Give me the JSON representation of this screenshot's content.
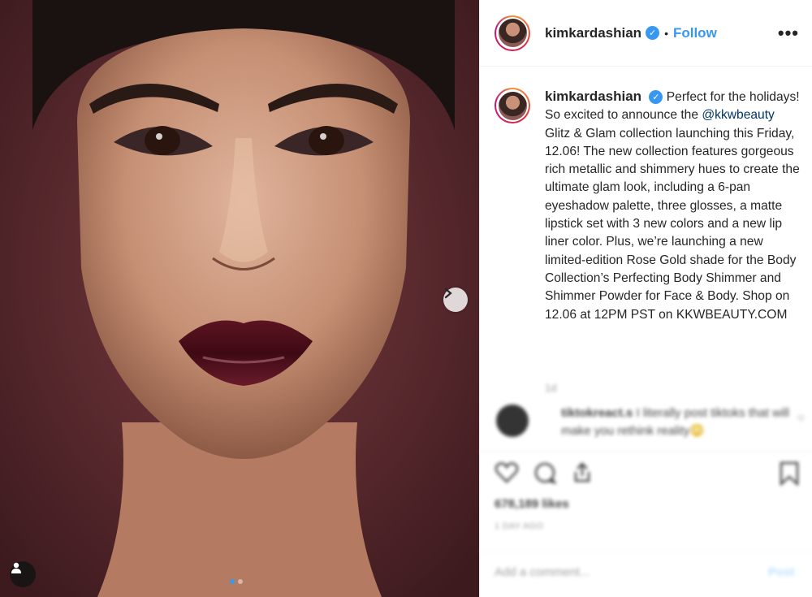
{
  "post": {
    "username": "kimkardashian",
    "verified_icon": "verified-badge-icon",
    "separator": "•",
    "follow_label": "Follow",
    "more_label": "•••",
    "caption_pre": "Perfect for the holidays! So excited to announce the ",
    "mention": "@kkwbeauty",
    "caption_post": " Glitz & Glam collection launching this Friday, 12.06! The new collection features gorgeous rich metallic and shimmery hues to create the ultimate glam look, including a 6-pan eyeshadow palette, three glosses, a matte lipstick set with 3 new colors and a new lip liner color. Plus, we’re launching a new limited-edition Rose Gold shade for the Body Collection’s Perfecting Body Shimmer and Shimmer Powder for Face & Body. Shop on 12.06 at 12PM PST on KKWBEAUTY.COM",
    "caption_age": "1d"
  },
  "comment": {
    "username": "tiktokreact.s",
    "text": "I literally post tiktoks that will make you rethink reality😳"
  },
  "actions": {
    "likes": "678,189 likes",
    "time": "1 DAY AGO",
    "comment_placeholder": "Add a comment...",
    "post_label": "Post"
  },
  "carousel": {
    "slide_count": 2,
    "active_slide": 1
  },
  "colors": {
    "accent": "#3897f0",
    "backdrop": "#5a2a2e",
    "lips": "#4a0d17"
  }
}
